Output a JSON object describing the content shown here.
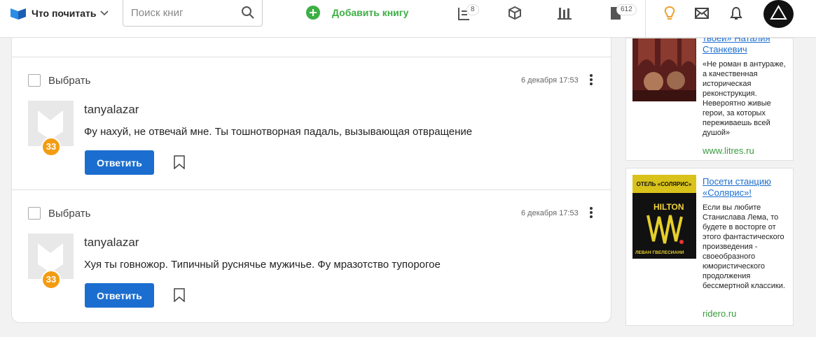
{
  "header": {
    "menu_label": "Что почитать",
    "search_placeholder": "Поиск книг",
    "add_book_label": "Добавить книгу",
    "badges": {
      "shelf": "8",
      "docs": "612"
    }
  },
  "messages": [
    {
      "select_label": "Выбрать",
      "date": "6 декабря 17:53",
      "username": "tanyalazar",
      "level": "33",
      "text": "Фу нахуй, не отвечай мне. Ты тошнотворная падаль, вызывающая отвращение",
      "reply_label": "Ответить"
    },
    {
      "select_label": "Выбрать",
      "date": "6 декабря 17:53",
      "username": "tanyalazar",
      "level": "33",
      "text": "Хуя ты говножор. Типичный руснячье мужичье. Фу мразотство тупорогое",
      "reply_label": "Ответить"
    }
  ],
  "ads": [
    {
      "title_line1": "твоей» Наталия",
      "title_line2": "Станкевич",
      "description": "«Не роман в антураже, а качественная историческая реконструкция. Невероятно живые герои, за которых переживаешь всей душой»",
      "site": "www.litres.ru"
    },
    {
      "title": "Посети станцию «Солярис»!",
      "description": "Если вы любите Станислава Лема, то будете в восторге от этого фантастического произведения - своеобразного юмористического продолжения бессмертной классики.",
      "site": "ridero.ru",
      "cover_text": {
        "top": "ОТЕЛЬ «СОЛЯРИС»",
        "middle": "HILTON",
        "author": "ЛЕВАН ГВЕЛЕСИАНИ"
      }
    }
  ]
}
